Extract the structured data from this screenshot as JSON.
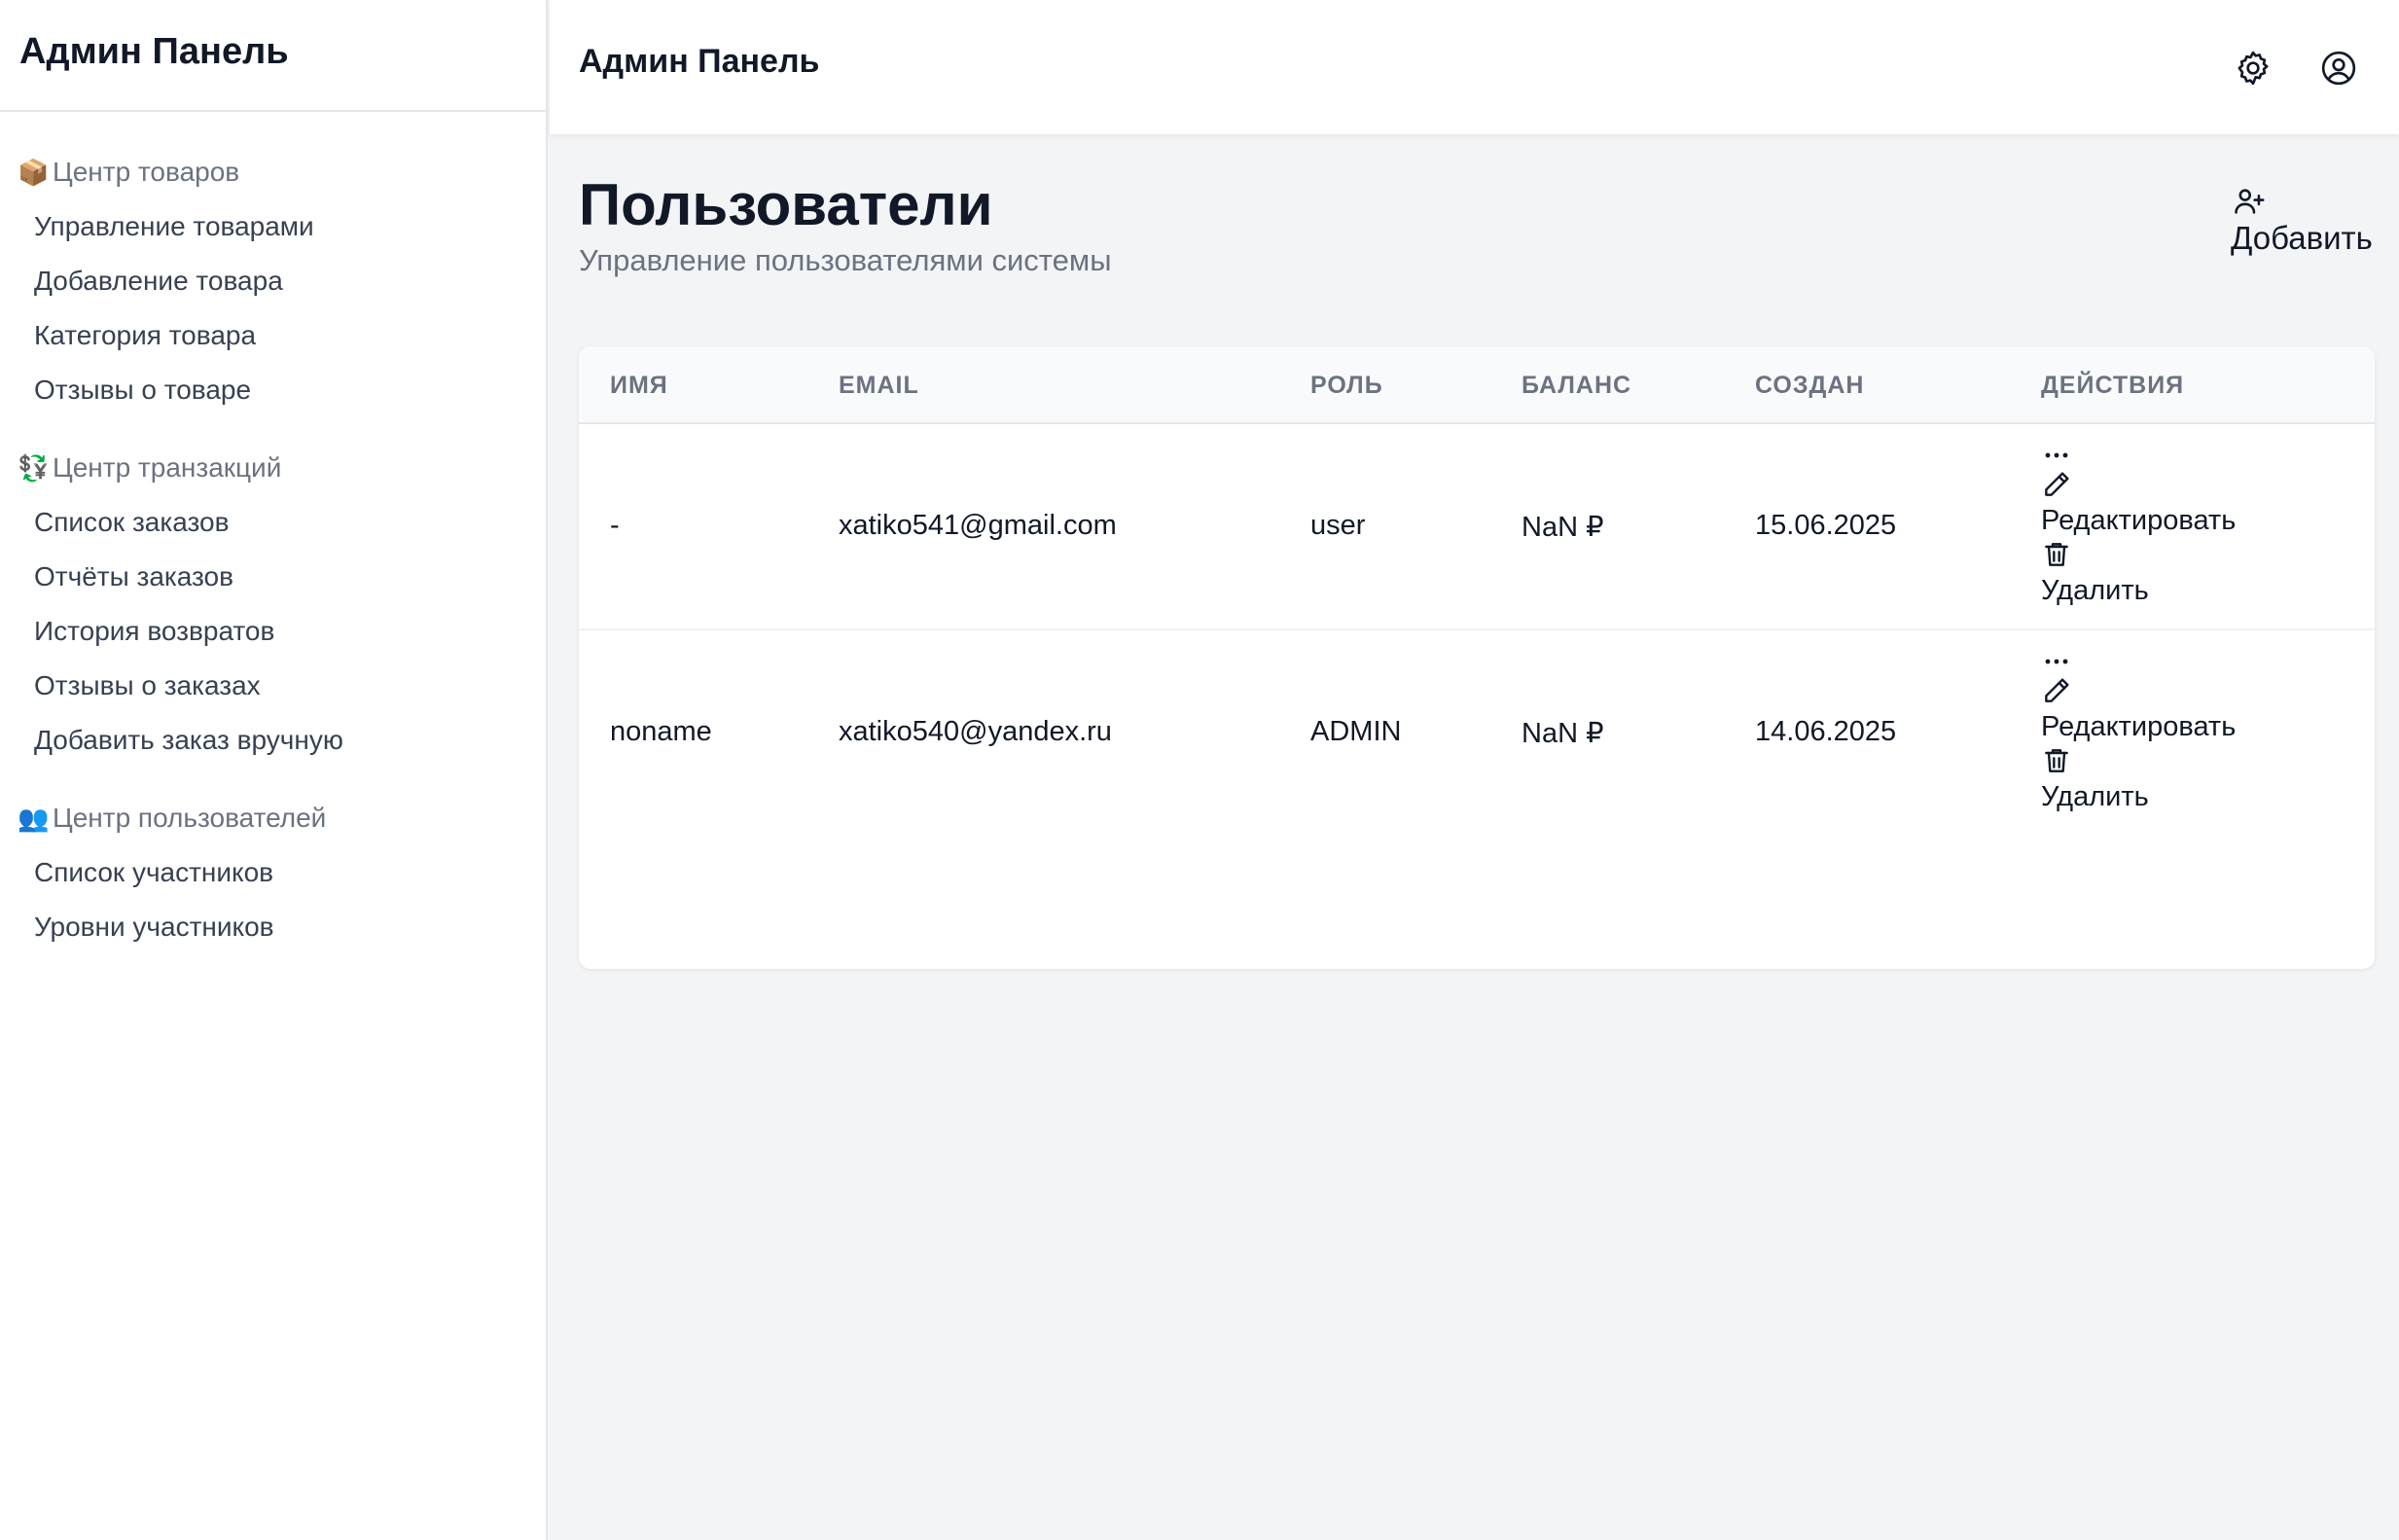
{
  "sidebar": {
    "brand": "Админ Панель",
    "sections": [
      {
        "emoji": "📦",
        "title": "Центр товаров",
        "items": [
          "Управление товарами",
          "Добавление товара",
          "Категория товара",
          "Отзывы о товаре"
        ]
      },
      {
        "emoji": "💱",
        "title": "Центр транзакций",
        "items": [
          "Список заказов",
          "Отчёты заказов",
          "История возвратов",
          "Отзывы о заказах",
          "Добавить заказ вручную"
        ]
      },
      {
        "emoji": "👥",
        "title": "Центр пользователей",
        "items": [
          "Список участников",
          "Уровни участников"
        ]
      }
    ]
  },
  "header": {
    "title": "Админ Панель",
    "icons": [
      "gear-icon",
      "user-circle-icon"
    ]
  },
  "page": {
    "title": "Пользователи",
    "subtitle": "Управление пользователями системы",
    "add_label": "Добавить",
    "add_icon": "user-plus-icon"
  },
  "table": {
    "headers": [
      "ИМЯ",
      "EMAIL",
      "РОЛЬ",
      "БАЛАНС",
      "СОЗДАН",
      "ДЕЙСТВИЯ"
    ],
    "rows": [
      {
        "name": "-",
        "email": "xatiko541@gmail.com",
        "role": "user",
        "balance": "NaN ₽",
        "created": "15.06.2025"
      },
      {
        "name": "noname",
        "email": "xatiko540@yandex.ru",
        "role": "ADMIN",
        "balance": "NaN ₽",
        "created": "14.06.2025"
      }
    ],
    "actions": {
      "more": "...",
      "edit": "Редактировать",
      "delete": "Удалить"
    }
  }
}
